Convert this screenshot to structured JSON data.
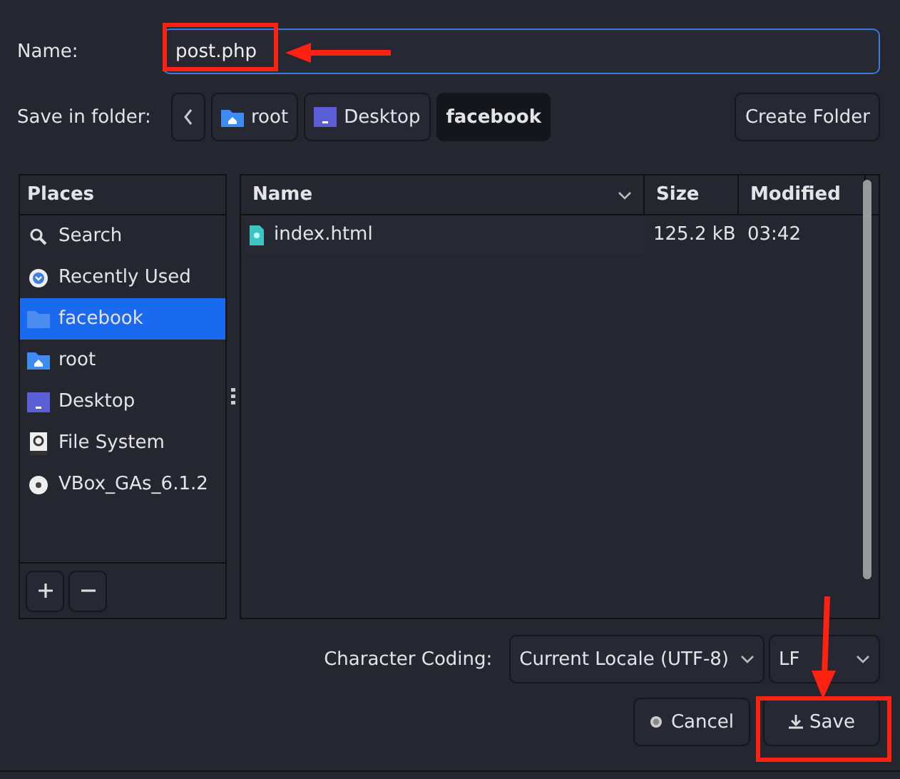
{
  "name_field": {
    "label": "Name:",
    "value": "post.php"
  },
  "folder_bar": {
    "label": "Save in folder:",
    "crumbs": [
      {
        "label": "root",
        "kind": "home",
        "selected": false
      },
      {
        "label": "Desktop",
        "kind": "desktop",
        "selected": false
      },
      {
        "label": "facebook",
        "kind": "plain",
        "selected": true
      }
    ],
    "create_button": "Create Folder"
  },
  "places": {
    "title": "Places",
    "items": [
      {
        "label": "Search",
        "kind": "search",
        "selected": false
      },
      {
        "label": "Recently Used",
        "kind": "recent",
        "selected": false
      },
      {
        "label": "facebook",
        "kind": "folder",
        "selected": true
      },
      {
        "label": "root",
        "kind": "home",
        "selected": false
      },
      {
        "label": "Desktop",
        "kind": "desktop",
        "selected": false
      },
      {
        "label": "File System",
        "kind": "drive",
        "selected": false
      },
      {
        "label": "VBox_GAs_6.1.2",
        "kind": "disc",
        "selected": false
      }
    ]
  },
  "files": {
    "columns": [
      "Name",
      "Size",
      "Modified"
    ],
    "rows": [
      {
        "name": "index.html",
        "size": "125.2 kB",
        "modified": "03:42"
      }
    ]
  },
  "encoding": {
    "label": "Character Coding:",
    "value": "Current Locale (UTF-8)",
    "line_ending": "LF"
  },
  "buttons": [
    {
      "label": "Cancel",
      "kind": "cancel"
    },
    {
      "label": "Save",
      "kind": "save"
    }
  ]
}
